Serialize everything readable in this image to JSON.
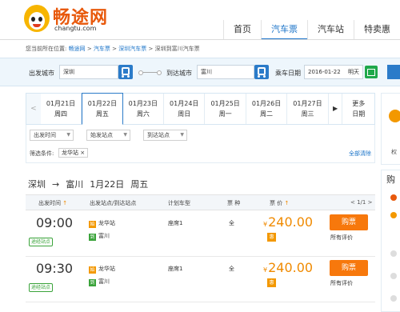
{
  "brand": {
    "name": "畅途网",
    "domain": "changtu.com"
  },
  "nav": {
    "items": [
      "首页",
      "汽车票",
      "汽车站",
      "特卖惠"
    ],
    "active_index": 1
  },
  "breadcrumb": {
    "prefix": "您当前所在位置:",
    "items": [
      "畅途网",
      "汽车票",
      "深圳汽车票",
      "深圳到富川汽车票"
    ]
  },
  "search": {
    "from_label": "出发城市",
    "from_value": "深圳",
    "to_label": "到达城市",
    "to_value": "富川",
    "date_label": "乘车日期",
    "date_value": "2016-01-22",
    "date_day": "明天"
  },
  "dates": {
    "items": [
      {
        "date": "01月21日",
        "week": "周四"
      },
      {
        "date": "01月22日",
        "week": "周五"
      },
      {
        "date": "01月23日",
        "week": "周六"
      },
      {
        "date": "01月24日",
        "week": "周日"
      },
      {
        "date": "01月25日",
        "week": "周一"
      },
      {
        "date": "01月26日",
        "week": "周二"
      },
      {
        "date": "01月27日",
        "week": "周三"
      }
    ],
    "active_index": 1,
    "more_line1": "更多",
    "more_line2": "日期"
  },
  "filters": {
    "selects": [
      "出发时间",
      "始发站点",
      "到达站点"
    ],
    "condition_label": "筛选条件:",
    "condition_tag": "龙华站",
    "clear_label": "全部清除"
  },
  "route": {
    "from": "深圳",
    "arrow": "→",
    "to": "富川",
    "date": "1月22日",
    "week": "周五"
  },
  "table": {
    "headers": {
      "time": "出发时间",
      "station": "出发站点/到达站点",
      "type": "计划车型",
      "ticket": "票 种",
      "price": "票 价"
    },
    "pager": "< 1/1 >",
    "rows": [
      {
        "time": "09:00",
        "badge": "途经站点",
        "from": "龙华站",
        "to": "富川",
        "from_mark": "始",
        "to_mark": "到",
        "type": "座席1",
        "seat": "全",
        "price": "240.00",
        "yen": "¥",
        "price_tag": "惠",
        "buy": "购票",
        "eval": "所有评价"
      },
      {
        "time": "09:30",
        "badge": "途经站点",
        "from": "龙华站",
        "to": "富川",
        "from_mark": "始",
        "to_mark": "到",
        "type": "座席1",
        "seat": "全",
        "price": "240.00",
        "yen": "¥",
        "price_tag": "惠",
        "buy": "购票",
        "eval": "所有评价"
      }
    ]
  },
  "side": {
    "panel1_text": "权",
    "panel2_title": "购"
  },
  "colors": {
    "accent": "#1a73c8",
    "orange": "#f08a00",
    "green": "#3aa33a"
  }
}
